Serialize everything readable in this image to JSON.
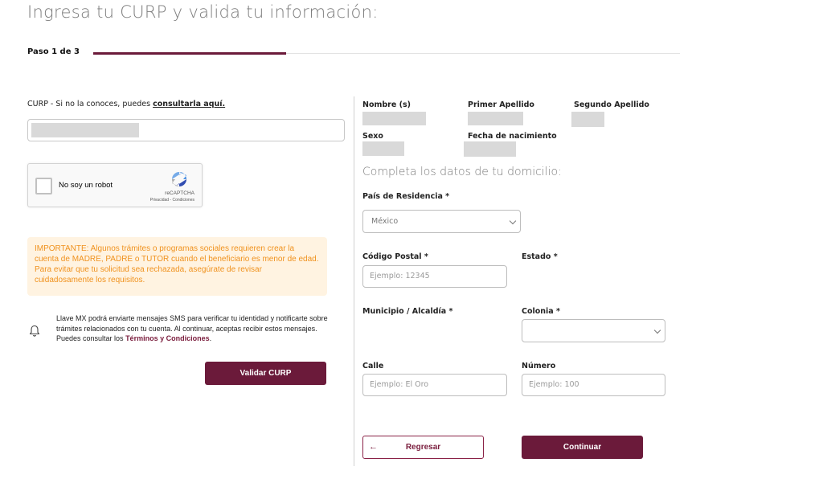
{
  "header": {
    "title": "Ingresa tu CURP y valida tu información:",
    "step_label": "Paso 1 de 3",
    "progress": 0.33
  },
  "curp": {
    "label_prefix": "CURP - Si no la conoces, puedes ",
    "link": "consultarla aquí."
  },
  "recaptcha": {
    "label": "No soy un robot",
    "brand": "reCAPTCHA",
    "links": "Privacidad - Condiciones"
  },
  "notice": {
    "text": "IMPORTANTE: Algunos trámites o programas sociales requieren crear la cuenta de MADRE, PADRE o TUTOR cuando el beneficiario es menor de edad. Para evitar que tu solicitud sea rechazada, asegúrate de revisar cuidadosamente los requisitos."
  },
  "sms": {
    "text": "Llave MX podrá enviarte mensajes SMS para verificar tu identidad y notificarte sobre trámites relacionados con tu cuenta. Al continuar, aceptas recibir estos mensajes. Puedes consultar los ",
    "terms": "Términos y Condiciones",
    "end": "."
  },
  "validate_button": "Validar CURP",
  "identity": {
    "nombre_label": "Nombre (s)",
    "primer_apellido_label": "Primer Apellido",
    "segundo_apellido_label": "Segundo Apellido",
    "sexo_label": "Sexo",
    "fecha_label": "Fecha de nacimiento"
  },
  "address": {
    "title": "Completa los datos de tu domicilio:",
    "pais_label": "País de Residencia *",
    "pais_value": "México",
    "cp_label": "Código Postal *",
    "cp_placeholder": "Ejemplo: 12345",
    "estado_label": "Estado *",
    "municipio_label": "Municipio / Alcaldía *",
    "colonia_label": "Colonia *",
    "calle_label": "Calle",
    "calle_placeholder": "Ejemplo: El Oro",
    "numero_label": "Número",
    "numero_placeholder": "Ejemplo: 100"
  },
  "actions": {
    "back": "Regresar",
    "continue": "Continuar"
  },
  "colors": {
    "brand": "#6b1a3a",
    "notice_text": "#f0921e",
    "notice_bg": "#fff3e1"
  }
}
